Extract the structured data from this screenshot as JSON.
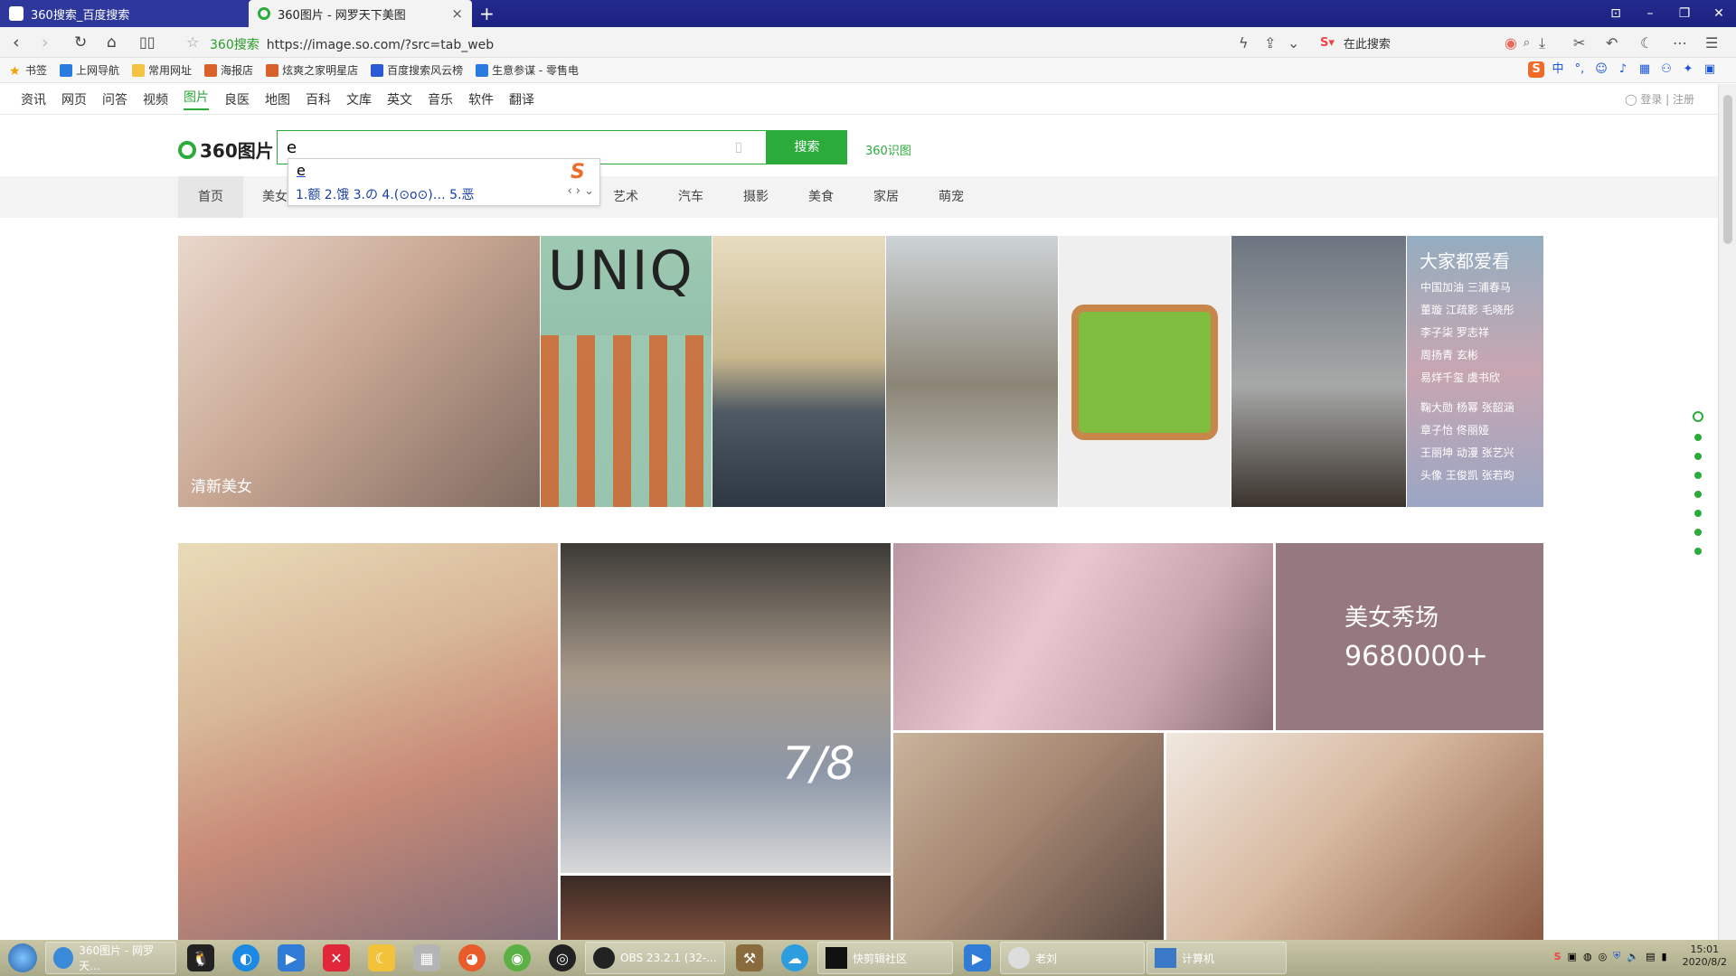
{
  "tabs": [
    {
      "title": "360搜索_百度搜索"
    },
    {
      "title": "360图片 - 网罗天下美图"
    }
  ],
  "address": {
    "site_label": "360搜索",
    "url": "https://image.so.com/?src=tab_web",
    "search_placeholder": "在此搜索"
  },
  "bookmarks": [
    "书签",
    "上网导航",
    "常用网址",
    "海报店",
    "炫爽之家明星店",
    "百度搜索风云榜",
    "生意参谋 - 零售电"
  ],
  "ime": {
    "mode": "中"
  },
  "topnav": [
    "资讯",
    "网页",
    "问答",
    "视频",
    "图片",
    "良医",
    "地图",
    "百科",
    "文库",
    "英文",
    "音乐",
    "软件",
    "翻译"
  ],
  "login": "登录 | 注册",
  "logo_text": "360图片",
  "search": {
    "value": "e",
    "button": "搜索",
    "shitu": "360识图"
  },
  "suggestion": {
    "typed": "e",
    "candidates": "1.额  2.饿  3.の  4.(⊙o⊙)…  5.恶"
  },
  "categories": [
    "首页",
    "美女",
    "艺术",
    "汽车",
    "摄影",
    "美食",
    "家居",
    "萌宠"
  ],
  "banner_label": "清新美女",
  "hot": {
    "title": "大家都爱看",
    "lines": [
      "中国加油  三浦春马",
      "董璇  江疏影  毛晓彤",
      "李子柒  罗志祥",
      "周扬青  玄彬",
      "易烊千玺  虞书欣",
      "鞠大勋  杨幂  张韶涵",
      "章子怡  佟丽娅",
      "王丽坤  动漫  张艺兴",
      "头像  王俊凯  张若昀"
    ]
  },
  "promo": {
    "line1": "美女秀场",
    "line2": "9680000+"
  },
  "taskbar": {
    "items": [
      "360图片 - 网罗天...",
      "OBS 23.2.1 (32-...",
      "快剪辑社区",
      "老刘",
      "计算机"
    ],
    "time": "15:01",
    "date": "2020/8/2"
  },
  "colors": {
    "accent": "#2bab3a",
    "tabbar": "#232a8e",
    "promo": "#96797e"
  }
}
